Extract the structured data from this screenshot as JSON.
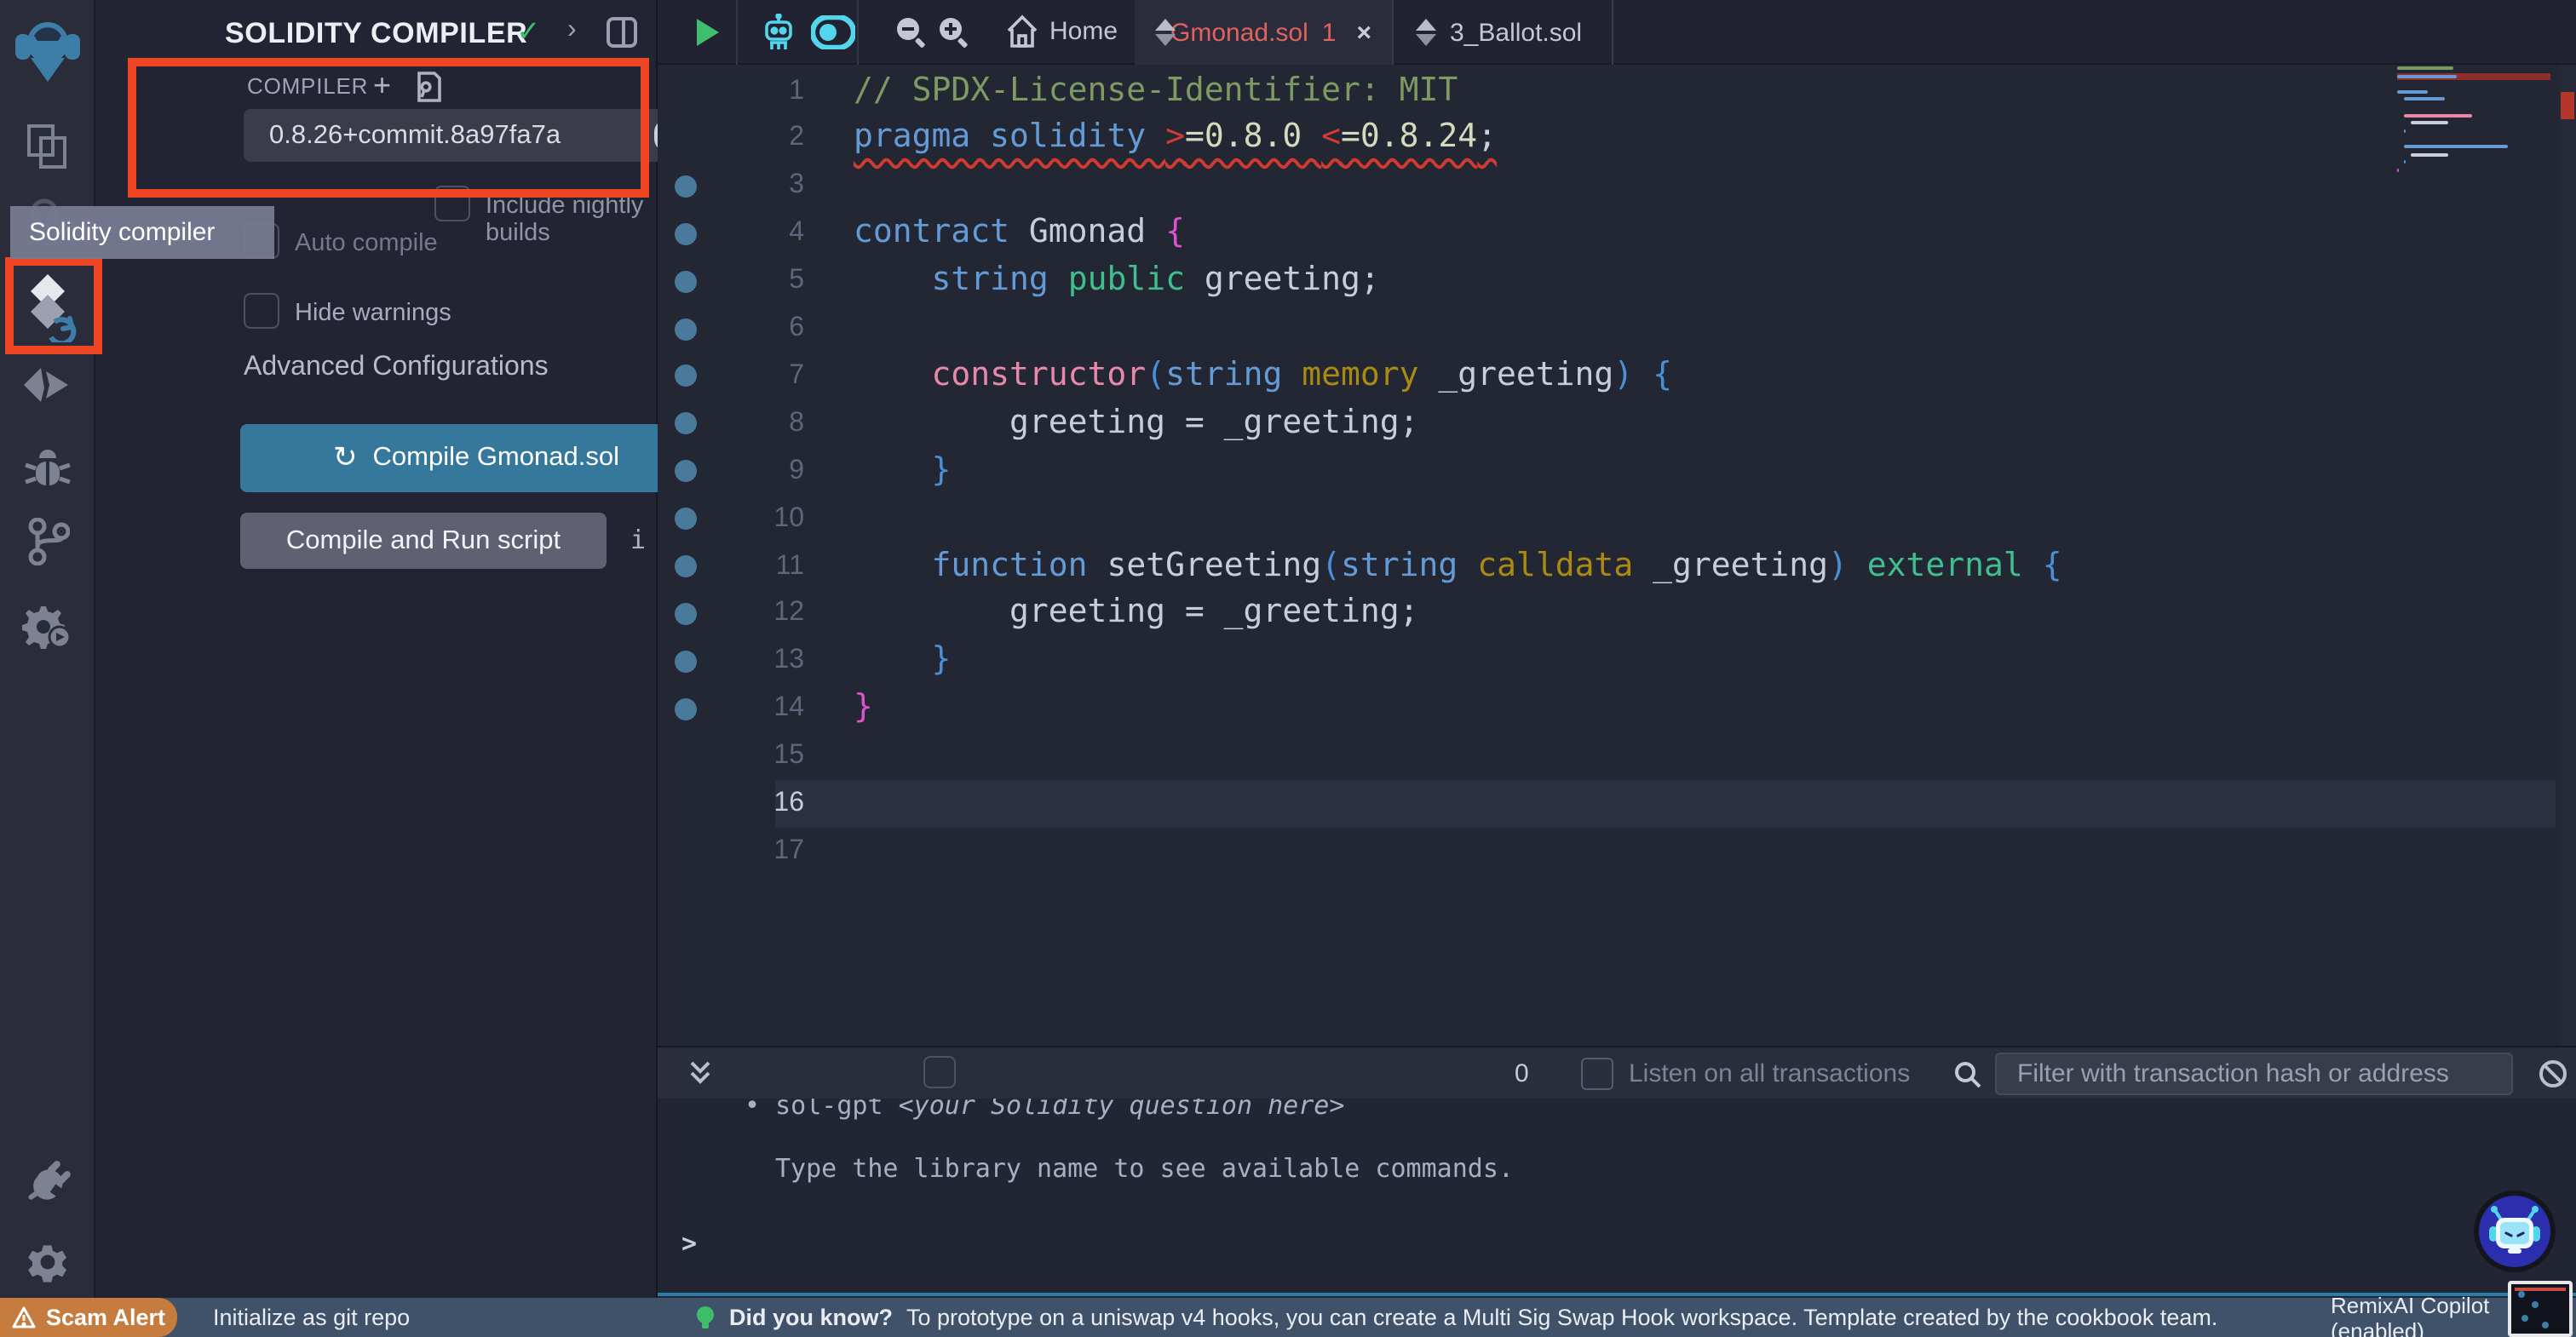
{
  "activity_bar": {
    "tooltip": "Solidity compiler",
    "icons": [
      "remix-logo",
      "file-explorer",
      "search",
      "solidity-compiler",
      "deploy-run",
      "debugger",
      "git",
      "plugin-runner",
      "plugin-manager",
      "settings"
    ]
  },
  "side_panel": {
    "title": "SOLIDITY COMPILER",
    "header_icons": [
      "check",
      "chevron-right",
      "split-panel"
    ],
    "section_label": "COMPILER",
    "section_icons": [
      "add",
      "license-file"
    ],
    "version_selected": "0.8.26+commit.8a97fa7a",
    "checkboxes": [
      {
        "label": "Include nightly builds",
        "checked": false
      },
      {
        "label": "Auto compile",
        "checked": false
      },
      {
        "label": "Hide warnings",
        "checked": false
      }
    ],
    "advanced_label": "Advanced Configurations",
    "compile_button": "Compile Gmonad.sol",
    "compile_run_button": "Compile and Run script"
  },
  "tab_bar": {
    "home_label": "Home",
    "tabs": [
      {
        "label": "Gmonad.sol",
        "badge": "1",
        "active": true,
        "error": true,
        "close": "×"
      },
      {
        "label": "3_Ballot.sol",
        "badge": "",
        "active": false,
        "error": false,
        "close": ""
      }
    ]
  },
  "editor": {
    "line_count": 17,
    "current_line": 16,
    "dot_lines": [
      3,
      4,
      5,
      6,
      7,
      8,
      9,
      10,
      11,
      12,
      13,
      14
    ],
    "error_line": 2,
    "token_colors": {
      "kw": "#649bd6",
      "comment": "#7e9a63",
      "op": "#d23b34",
      "num": "#d2dbbd",
      "plain": "#c9cdd9",
      "fn": "#e989a9",
      "mod": "#ab8a12",
      "vis": "#3fbf8e",
      "brace": "#4a90d9",
      "cbrace": "#dd52d0"
    },
    "lines": [
      {
        "n": 1,
        "squiggle": false,
        "tokens": [
          [
            "comment",
            "// SPDX-License-Identifier: MIT"
          ]
        ]
      },
      {
        "n": 2,
        "squiggle": true,
        "tokens": [
          [
            "kw",
            "pragma solidity "
          ],
          [
            "op",
            ">"
          ],
          [
            "num",
            "=0.8.0 "
          ],
          [
            "op",
            "<"
          ],
          [
            "num",
            "=0.8.24"
          ],
          [
            "plain",
            ";"
          ]
        ]
      },
      {
        "n": 3,
        "squiggle": false,
        "tokens": []
      },
      {
        "n": 4,
        "squiggle": false,
        "tokens": [
          [
            "kw",
            "contract "
          ],
          [
            "plain",
            "Gmonad "
          ],
          [
            "cbrace",
            "{"
          ]
        ]
      },
      {
        "n": 5,
        "squiggle": false,
        "tokens": [
          [
            "kw",
            "    string "
          ],
          [
            "vis",
            "public "
          ],
          [
            "plain",
            "greeting;"
          ]
        ]
      },
      {
        "n": 6,
        "squiggle": false,
        "tokens": []
      },
      {
        "n": 7,
        "squiggle": false,
        "tokens": [
          [
            "fn",
            "    constructor"
          ],
          [
            "brace",
            "("
          ],
          [
            "kw",
            "string "
          ],
          [
            "mod",
            "memory "
          ],
          [
            "plain",
            "_greeting"
          ],
          [
            "brace",
            ") "
          ],
          [
            "brace",
            "{"
          ]
        ]
      },
      {
        "n": 8,
        "squiggle": false,
        "tokens": [
          [
            "plain",
            "        greeting = _greeting;"
          ]
        ]
      },
      {
        "n": 9,
        "squiggle": false,
        "tokens": [
          [
            "brace",
            "    }"
          ]
        ]
      },
      {
        "n": 10,
        "squiggle": false,
        "tokens": []
      },
      {
        "n": 11,
        "squiggle": false,
        "tokens": [
          [
            "kw",
            "    function "
          ],
          [
            "plain",
            "setGreeting"
          ],
          [
            "brace",
            "("
          ],
          [
            "kw",
            "string "
          ],
          [
            "mod",
            "calldata "
          ],
          [
            "plain",
            "_greeting"
          ],
          [
            "brace",
            ")"
          ],
          [
            "vis",
            " external "
          ],
          [
            "brace",
            "{"
          ]
        ]
      },
      {
        "n": 12,
        "squiggle": false,
        "tokens": [
          [
            "plain",
            "        greeting = _greeting;"
          ]
        ]
      },
      {
        "n": 13,
        "squiggle": false,
        "tokens": [
          [
            "brace",
            "    }"
          ]
        ]
      },
      {
        "n": 14,
        "squiggle": false,
        "tokens": [
          [
            "cbrace",
            "}"
          ]
        ]
      },
      {
        "n": 15,
        "squiggle": false,
        "tokens": []
      },
      {
        "n": 16,
        "squiggle": false,
        "tokens": []
      },
      {
        "n": 17,
        "squiggle": false,
        "tokens": []
      }
    ]
  },
  "terminal": {
    "tx_count": "0",
    "listen_label": "Listen on all transactions",
    "filter_placeholder": "Filter with transaction hash or address",
    "history_bullet": "• sol-gpt ",
    "history_hint": "<your Solidity question here>",
    "history_help": "Type the library name to see available commands.",
    "prompt": ">"
  },
  "status_bar": {
    "scam_alert": "Scam Alert",
    "git_label": "Initialize as git repo",
    "did_you_know_label": "Did you know?",
    "did_you_know_text": "To prototype on a uniswap v4 hooks, you can create a Multi Sig Swap Hook workspace. Template created by the cookbook team.",
    "copilot_label": "RemixAI Copilot (enabled)"
  },
  "colors": {
    "annotation_red": "#ee4623",
    "accent_blue": "#35789b",
    "error_red": "#e0635f",
    "success_green": "#3fbe6c",
    "cyan": "#53d5ec"
  }
}
